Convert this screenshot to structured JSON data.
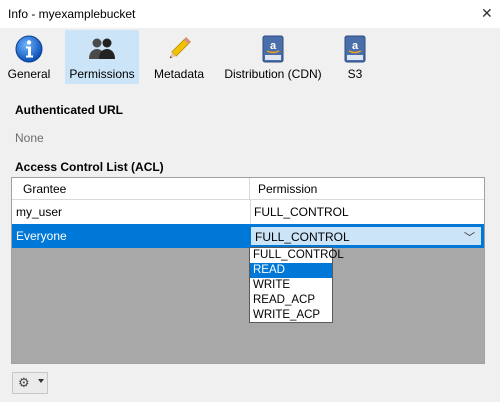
{
  "window": {
    "title": "Info - myexamplebucket"
  },
  "toolbar": {
    "items": [
      {
        "label": "General",
        "icon": "info-icon"
      },
      {
        "label": "Permissions",
        "icon": "users-icon"
      },
      {
        "label": "Metadata",
        "icon": "pencil-icon"
      },
      {
        "label": "Distribution (CDN)",
        "icon": "amazon-drive-icon"
      },
      {
        "label": "S3",
        "icon": "amazon-drive-icon"
      }
    ],
    "selected": "Permissions"
  },
  "auth_url": {
    "heading": "Authenticated URL",
    "value": "None"
  },
  "acl": {
    "heading": "Access Control List (ACL)",
    "columns": [
      "Grantee",
      "Permission"
    ],
    "rows": [
      {
        "grantee": "my_user",
        "permission": "FULL_CONTROL"
      },
      {
        "grantee": "Everyone",
        "permission": "FULL_CONTROL"
      }
    ],
    "selected_row": "Everyone"
  },
  "dropdown": {
    "options": [
      "FULL_CONTROL",
      "READ",
      "WRITE",
      "READ_ACP",
      "WRITE_ACP"
    ],
    "highlighted": "READ"
  },
  "colors": {
    "accent": "#0078d7",
    "selected_tab": "#cce4f7",
    "table_bg": "#a8a8a8"
  }
}
